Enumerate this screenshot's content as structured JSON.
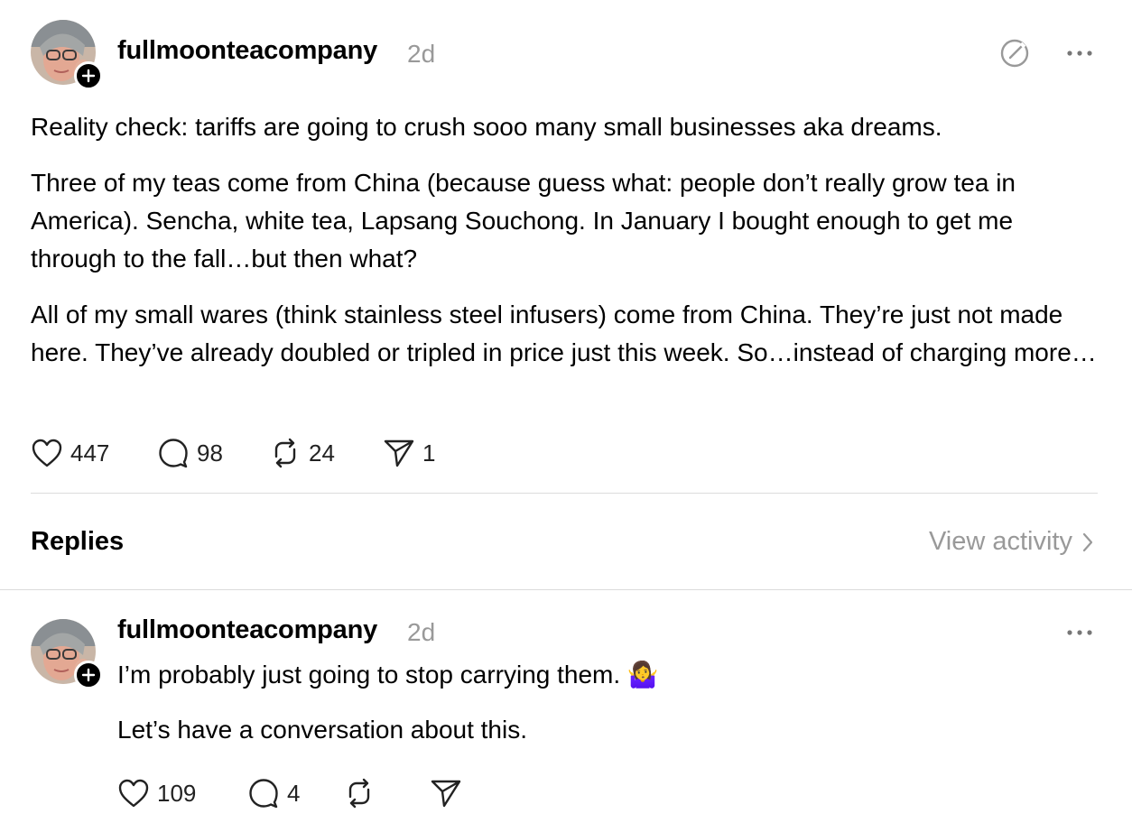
{
  "post": {
    "username": "fullmoonteacompany",
    "time": "2d",
    "paragraphs": [
      "Reality check: tariffs are going to crush sooo many small businesses aka dreams.",
      "Three of my teas come from China (because guess what: people don’t really grow tea in America). Sencha, white tea, Lapsang Souchong. In January I bought enough to get me through to the fall…but then what?",
      "All of my small wares (think stainless steel infusers) come from China. They’re just not made here. They’ve already doubled or tripled in price just this week. So…instead of charging more…"
    ],
    "likes": "447",
    "comments": "98",
    "reposts": "24",
    "shares": "1"
  },
  "replies_header": {
    "label": "Replies",
    "view_activity": "View activity"
  },
  "reply": {
    "username": "fullmoonteacompany",
    "time": "2d",
    "line1": "I’m probably just going to stop carrying them. 🤷‍♀️",
    "line2": "Let’s have a conversation about this.",
    "likes": "109",
    "comments": "4"
  },
  "icons": [
    "avatar",
    "follow-plus-icon",
    "edit-circle-icon",
    "more-icon",
    "heart-icon",
    "comment-icon",
    "repost-icon",
    "share-icon",
    "chevron-right-icon"
  ]
}
